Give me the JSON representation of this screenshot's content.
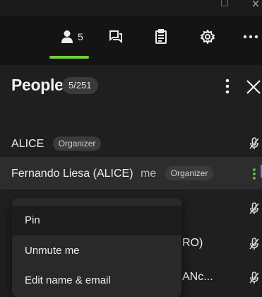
{
  "window": {
    "restore_glyph": "□",
    "close_glyph": "✕"
  },
  "toolbar": {
    "people_count": "5",
    "icons": [
      "person-icon",
      "chat-icon",
      "notes-icon",
      "gear-icon",
      "more-icon"
    ],
    "accent_color": "#6fcf3c"
  },
  "panel": {
    "title": "People",
    "count": "5/251"
  },
  "participants": [
    {
      "name": "ALICE",
      "badge": "Organizer"
    },
    {
      "name": "Fernando Liesa (ALICE)",
      "me": "me",
      "badge": "Organizer"
    }
  ],
  "partial_rows": [
    "RO)",
    "ANc..."
  ],
  "context_menu": {
    "items": [
      "Pin",
      "Unmute me",
      "Edit name & email"
    ]
  }
}
